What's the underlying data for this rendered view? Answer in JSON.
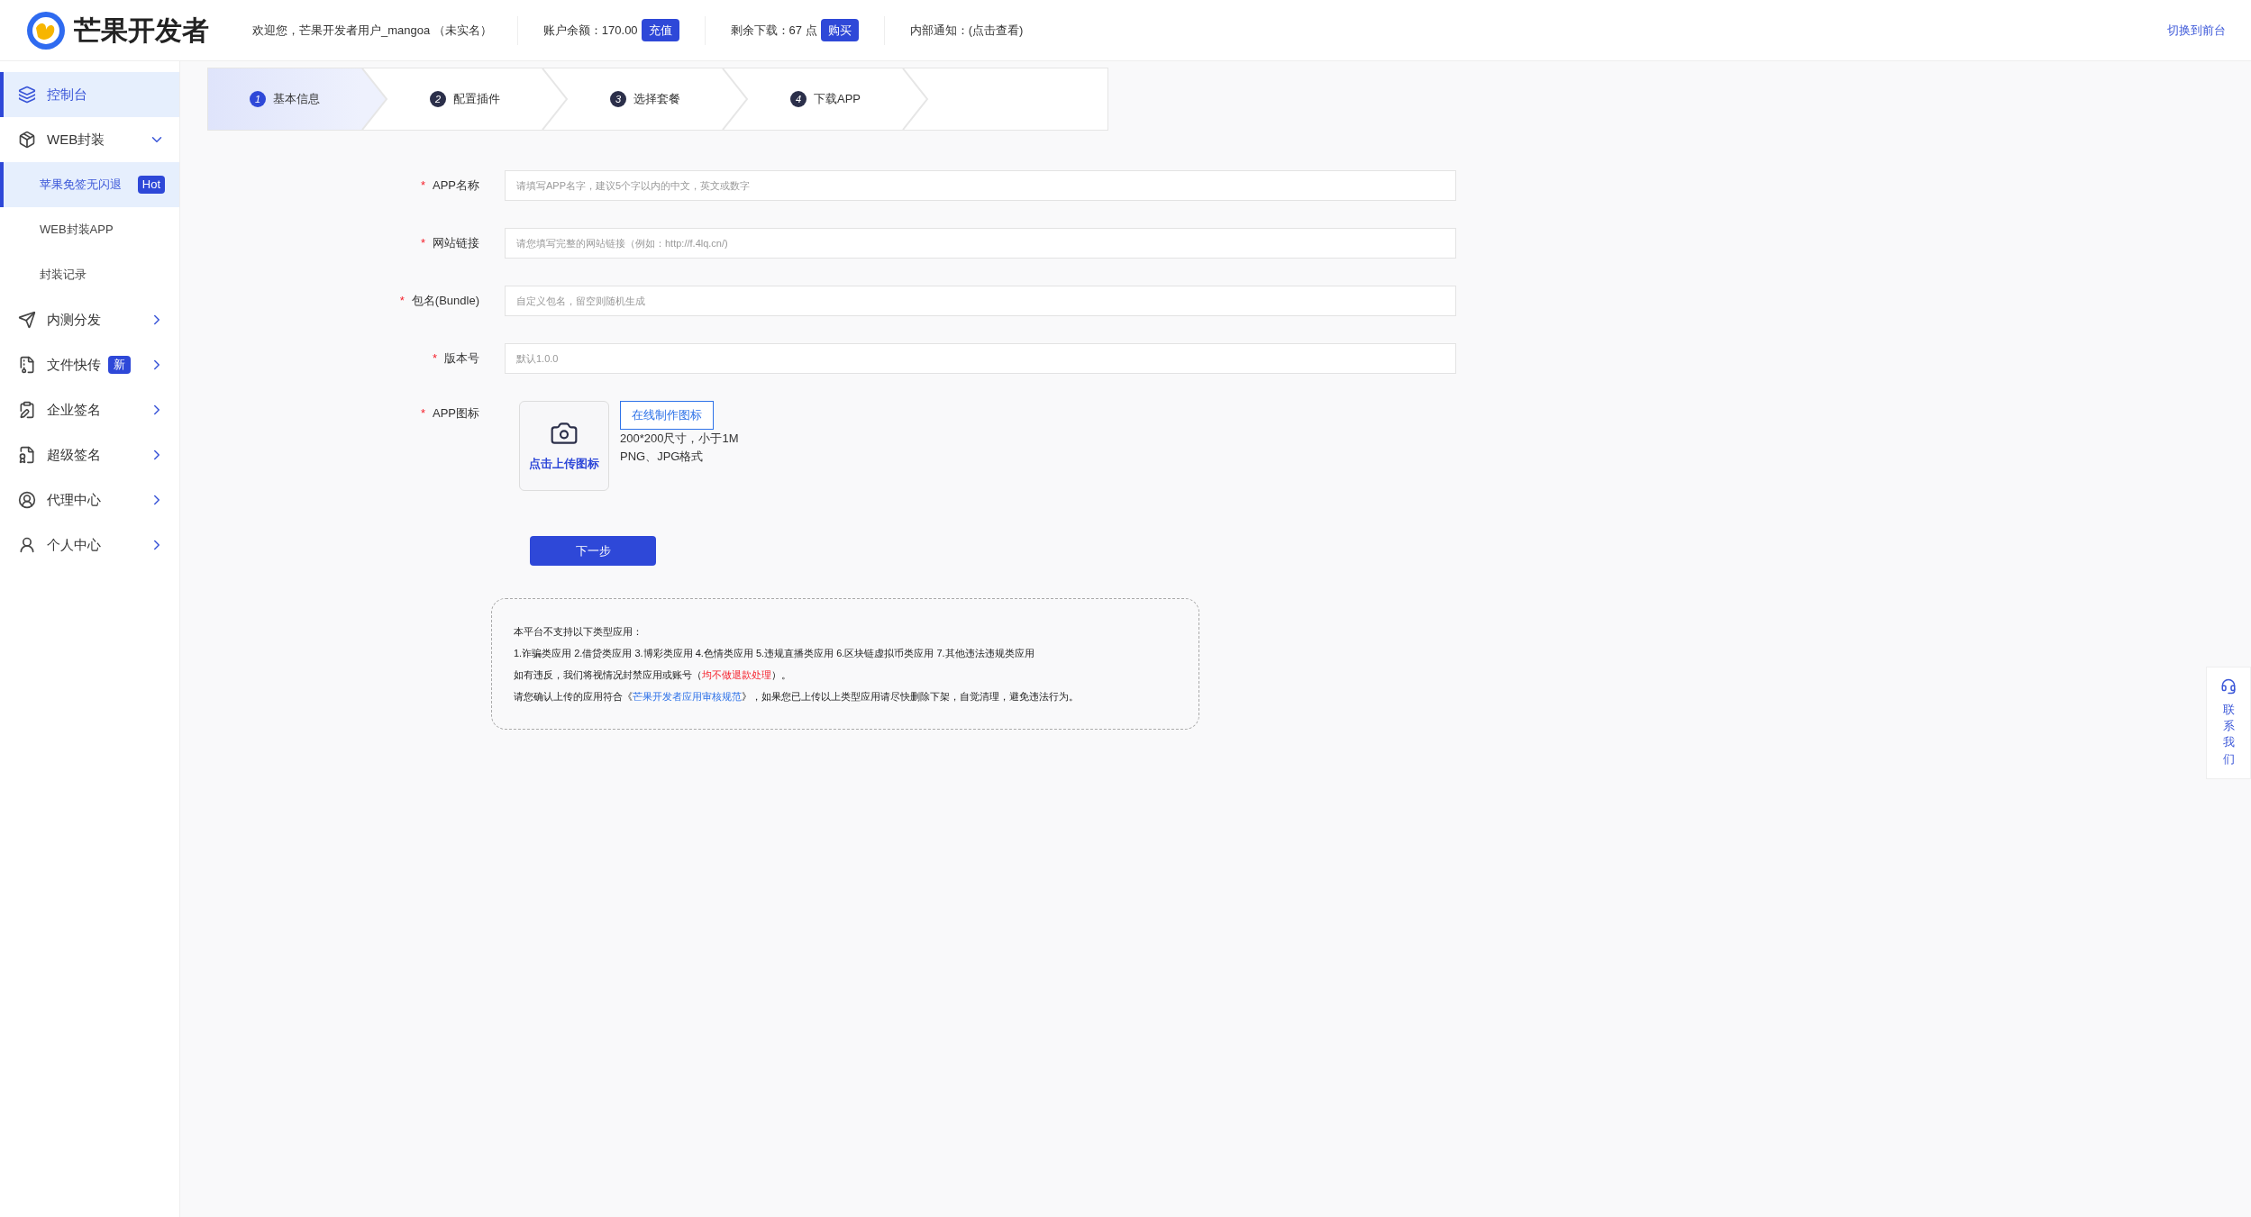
{
  "header": {
    "brand": "芒果开发者",
    "welcome": "欢迎您，芒果开发者用户_mangoa （未实名）",
    "balance": "账户余额：170.00",
    "recharge_button": "充值",
    "downloads": "剩余下载：67 点",
    "buy_button": "购买",
    "notice": "内部通知：(点击查看)",
    "switch_link": "切换到前台"
  },
  "sidebar": {
    "items": [
      {
        "label": "控制台",
        "selected": true
      },
      {
        "label": "WEB封装",
        "selected": false,
        "expanded": true,
        "children": [
          {
            "label": "苹果免签无闪退",
            "badge": "Hot",
            "selected": true
          },
          {
            "label": "WEB封装APP",
            "selected": false
          },
          {
            "label": "封装记录",
            "selected": false
          }
        ]
      },
      {
        "label": "内测分发",
        "selected": false,
        "expanded": false
      },
      {
        "label": "文件快传",
        "badge": "新",
        "selected": false,
        "expanded": false
      },
      {
        "label": "企业签名",
        "selected": false,
        "expanded": false
      },
      {
        "label": "超级签名",
        "selected": false,
        "expanded": false
      },
      {
        "label": "代理中心",
        "selected": false,
        "expanded": false
      },
      {
        "label": "个人中心",
        "selected": false,
        "expanded": false
      }
    ]
  },
  "steps": [
    {
      "number": "1",
      "label": "基本信息",
      "selected": true
    },
    {
      "number": "2",
      "label": "配置插件",
      "selected": false
    },
    {
      "number": "3",
      "label": "选择套餐",
      "selected": false
    },
    {
      "number": "4",
      "label": "下载APP",
      "selected": false
    }
  ],
  "form": {
    "fields": [
      {
        "label": "APP名称",
        "required_mark": "*",
        "placeholder": "请填写APP名字，建议5个字以内的中文，英文或数字"
      },
      {
        "label": "网站链接",
        "required_mark": "*",
        "placeholder": "请您填写完整的网站链接（例如：http://f.4lq.cn/)"
      },
      {
        "label": "包名(Bundle)",
        "required_mark": "*",
        "placeholder": "自定义包名，留空则随机生成"
      },
      {
        "label": "版本号",
        "required_mark": "*",
        "placeholder": "默认1.0.0"
      }
    ],
    "icon_field": {
      "label": "APP图标",
      "required_mark": "*",
      "upload_text": "点击上传图标",
      "make_button": "在线制作图标",
      "hints": [
        "200*200尺寸，小于1M",
        "PNG、JPG格式"
      ]
    },
    "next_button": "下一步"
  },
  "notice_box": {
    "lines": [
      [
        {
          "kind": "plain",
          "text": "本平台不支持以下类型应用："
        }
      ],
      [
        {
          "kind": "plain",
          "text": "1.诈骗类应用 2.借贷类应用 3.博彩类应用 4.色情类应用 5.违规直播类应用 6.区块链虚拟币类应用 7.其他违法违规类应用"
        }
      ],
      [
        {
          "kind": "plain",
          "text": "如有违反，我们将视情况封禁应用或账号（"
        },
        {
          "kind": "alert",
          "text": "均不做退款处理"
        },
        {
          "kind": "plain",
          "text": "）。"
        }
      ],
      [
        {
          "kind": "plain",
          "text": "请您确认上传的应用符合《"
        },
        {
          "kind": "link",
          "text": "芒果开发者应用审核规范"
        },
        {
          "kind": "plain",
          "text": "》，如果您已上传以上类型应用请尽快删除下架，自觉清理，避免违法行为。"
        }
      ]
    ]
  },
  "contact": {
    "label": "联系我们"
  }
}
